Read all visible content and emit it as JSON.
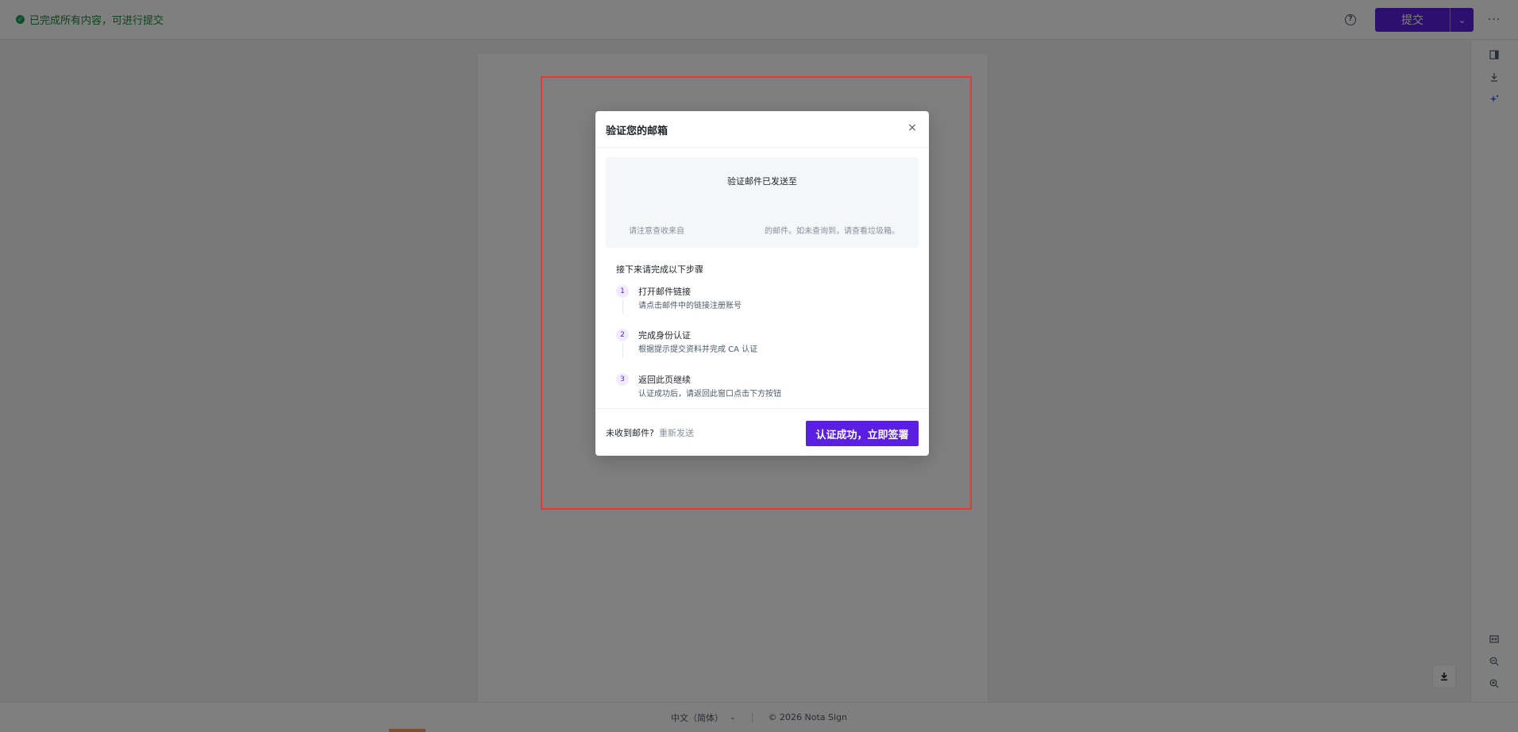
{
  "header": {
    "status_text": "已完成所有内容，可进行提交",
    "status_icon": "check-circle-icon",
    "help_icon": "question-circle-icon",
    "submit_label": "提交",
    "more_label": "···"
  },
  "rail": {
    "top_icons": [
      "sidebar-toggle-icon",
      "download-icon",
      "ai-sparkle-icon"
    ],
    "bottom_icons": [
      "fit-width-icon",
      "zoom-out-icon",
      "zoom-in-icon"
    ]
  },
  "dialog": {
    "title": "验证您的邮箱",
    "close_glyph": "×",
    "info": {
      "title": "验证邮件已发送至",
      "note_left": "请注意查收来自",
      "note_right": "的邮件。如未查询到，请查看垃圾箱。"
    },
    "steps_title": "接下来请完成以下步骤",
    "steps": [
      {
        "num": "1",
        "title": "打开邮件链接",
        "desc": "请点击邮件中的链接注册账号"
      },
      {
        "num": "2",
        "title": "完成身份认证",
        "desc": "根据提示提交资料并完成 CA 认证"
      },
      {
        "num": "3",
        "title": "返回此页继续",
        "desc": "认证成功后，请返回此窗口点击下方按钮"
      }
    ],
    "not_received": "未收到邮件?",
    "resend": "重新发送",
    "confirm": "认证成功，立即签署"
  },
  "footer": {
    "language": "中文（简体）",
    "copyright": "© 2026 Nota Sign"
  },
  "colors": {
    "brand": "#5a1fe0",
    "status_green": "#1f9d55",
    "highlight_border": "#e53935"
  }
}
